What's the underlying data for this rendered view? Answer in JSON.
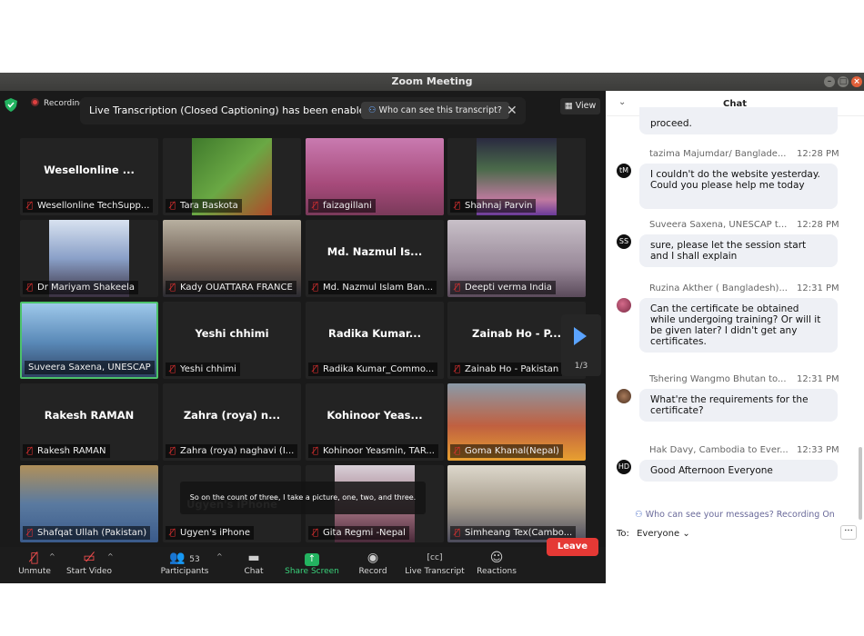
{
  "window": {
    "title": "Zoom Meeting"
  },
  "topbar": {
    "recording": "Recording",
    "banner_text": "Live Transcription (Closed Captioning) has been enabled",
    "banner_link": "Who can see this transcript?",
    "view": "View"
  },
  "tiles": [
    {
      "big": "Wesellonline ...",
      "name": "Wesellonline TechSupp..."
    },
    {
      "big": "",
      "name": "Tara Baskota"
    },
    {
      "big": "",
      "name": "faizagillani"
    },
    {
      "big": "",
      "name": "Shahnaj Parvin"
    },
    {
      "big": "",
      "name": "Dr Mariyam Shakeela"
    },
    {
      "big": "",
      "name": "Kady OUATTARA FRANCE"
    },
    {
      "big": "Md. Nazmul Is...",
      "name": "Md. Nazmul Islam Ban..."
    },
    {
      "big": "",
      "name": "Deepti verma India"
    },
    {
      "big": "",
      "name": "Suveera Saxena, UNESCAP"
    },
    {
      "big": "Yeshi chhimi",
      "name": "Yeshi chhimi"
    },
    {
      "big": "Radika Kumar...",
      "name": "Radika Kumar_Commo..."
    },
    {
      "big": "Zainab Ho - P...",
      "name": "Zainab Ho - Pakistan"
    },
    {
      "big": "Rakesh RAMAN",
      "name": "Rakesh RAMAN"
    },
    {
      "big": "Zahra (roya) n...",
      "name": "Zahra (roya) naghavi (I..."
    },
    {
      "big": "Kohinoor Yeas...",
      "name": "Kohinoor Yeasmin, TAR..."
    },
    {
      "big": "",
      "name": "Goma Khanal(Nepal)"
    },
    {
      "big": "",
      "name": "Shafqat Ullah (Pakistan)"
    },
    {
      "big": "Ugyen's iPhone",
      "name": "Ugyen's iPhone"
    },
    {
      "big": "",
      "name": "Gita Regmi -Nepal"
    },
    {
      "big": "",
      "name": "Simheang Tex(Cambo..."
    }
  ],
  "pager": "1/3",
  "caption": "So on the count of three, I take a picture, one, two, and three.",
  "toolbar": {
    "unmute": "Unmute",
    "start_video": "Start Video",
    "participants": "Participants",
    "participants_count": "53",
    "chat": "Chat",
    "share": "Share Screen",
    "record": "Record",
    "transcript": "Live Transcript",
    "reactions": "Reactions",
    "leave": "Leave"
  },
  "chat": {
    "title": "Chat",
    "partial": "proceed.",
    "messages": [
      {
        "sender": "tazima Majumdar/ Banglade...",
        "time": "12:28 PM",
        "avatar": "tM",
        "text": "I couldn't do the website yesterday. Could you please help me today"
      },
      {
        "sender": "Suveera Saxena, UNESCAP t...",
        "time": "12:28 PM",
        "avatar": "SS",
        "text": "sure, please let the session start and I shall explain"
      },
      {
        "sender": "Ruzina Akther ( Bangladesh)...",
        "time": "12:31 PM",
        "avatar": "",
        "text": "Can the certificate be obtained while undergoing training? Or will it be given later? I didn't get any certificates."
      },
      {
        "sender": "Tshering Wangmo Bhutan to...",
        "time": "12:31 PM",
        "avatar": "",
        "text": "What're the requirements for the certificate?"
      },
      {
        "sender": "Hak Davy, Cambodia to Ever...",
        "time": "12:33 PM",
        "avatar": "HD",
        "text": "Good Afternoon Everyone"
      }
    ],
    "notice": "Who can see your messages? Recording On",
    "to_label": "To:",
    "to_value": "Everyone"
  },
  "colors": {
    "accent_green": "#23b360",
    "leave_red": "#e53935",
    "active_border": "#4cc26a",
    "pager_arrow": "#5aa3ff"
  }
}
